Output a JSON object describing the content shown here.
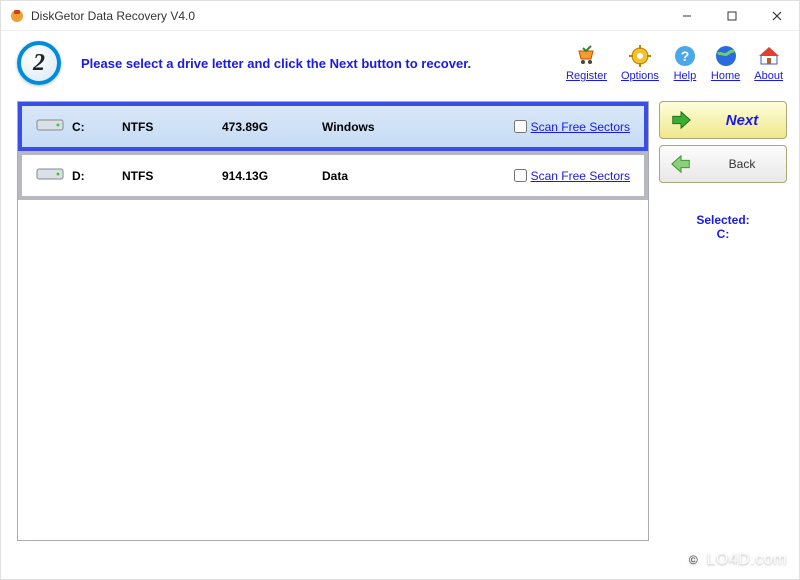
{
  "window": {
    "title": "DiskGetor Data Recovery  V4.0"
  },
  "step": {
    "number": "2",
    "instructions": "Please select a drive letter and click the Next button to recover."
  },
  "toolbar": {
    "register": "Register",
    "options": "Options",
    "help": "Help",
    "home": "Home",
    "about": "About"
  },
  "drives": [
    {
      "letter": "C:",
      "fs": "NTFS",
      "size": "473.89G",
      "label": "Windows",
      "scan_label": "Scan Free Sectors",
      "selected": true
    },
    {
      "letter": "D:",
      "fs": "NTFS",
      "size": "914.13G",
      "label": "Data",
      "scan_label": "Scan Free Sectors",
      "selected": false
    }
  ],
  "buttons": {
    "next": "Next",
    "back": "Back"
  },
  "selected": {
    "label": "Selected:",
    "value": "C:"
  },
  "watermark": "LO4D.com"
}
